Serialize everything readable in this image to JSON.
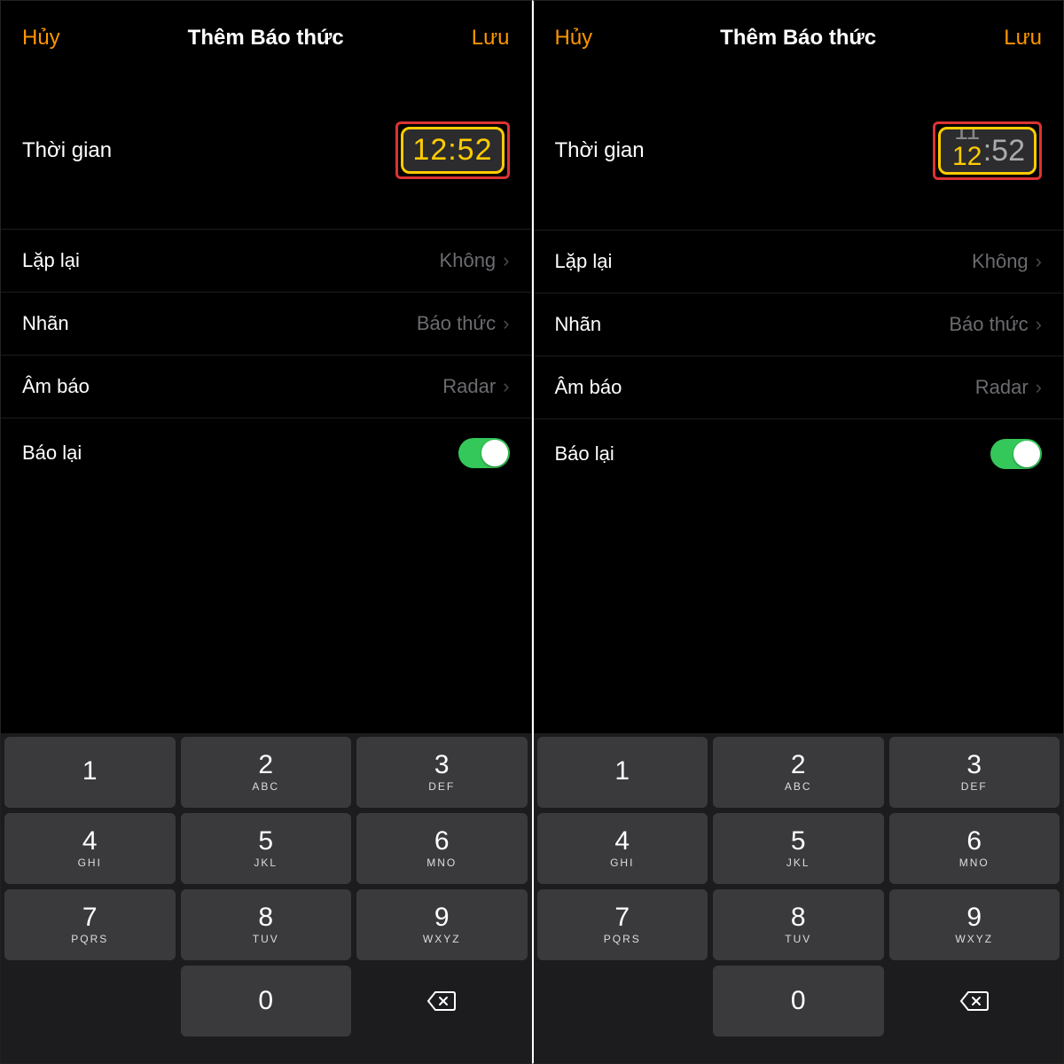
{
  "header": {
    "cancel": "Hủy",
    "title": "Thêm Báo thức",
    "save": "Lưu"
  },
  "time": {
    "label": "Thời gian",
    "valueA": "12:52",
    "rollTop": "11",
    "rollBottom": "12",
    "rollMin": ":52"
  },
  "settings": {
    "repeat_label": "Lặp lại",
    "repeat_value": "Không",
    "label_label": "Nhãn",
    "label_value": "Báo thức",
    "sound_label": "Âm báo",
    "sound_value": "Radar",
    "snooze_label": "Báo lại",
    "snooze_on": true
  },
  "keypad": {
    "keys": [
      {
        "d": "1",
        "s": ""
      },
      {
        "d": "2",
        "s": "ABC"
      },
      {
        "d": "3",
        "s": "DEF"
      },
      {
        "d": "4",
        "s": "GHI"
      },
      {
        "d": "5",
        "s": "JKL"
      },
      {
        "d": "6",
        "s": "MNO"
      },
      {
        "d": "7",
        "s": "PQRS"
      },
      {
        "d": "8",
        "s": "TUV"
      },
      {
        "d": "9",
        "s": "WXYZ"
      },
      {
        "d": "0",
        "s": ""
      }
    ]
  },
  "colors": {
    "accent": "#ff9500",
    "highlight": "#ffcc00",
    "switch": "#34c759",
    "annotate": "#d33"
  }
}
